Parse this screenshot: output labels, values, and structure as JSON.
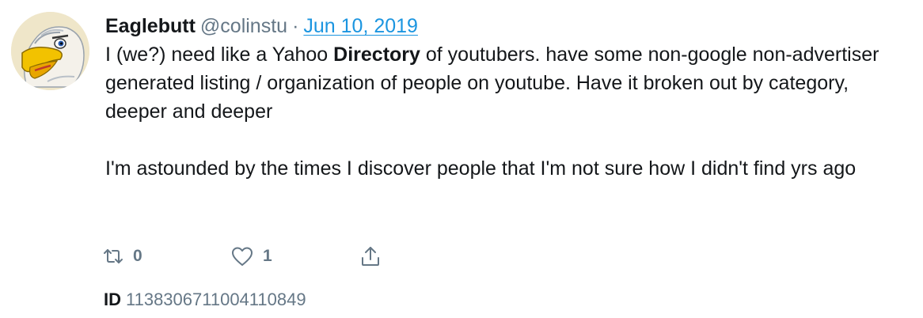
{
  "tweet": {
    "display_name": "Eaglebutt",
    "handle": "@colinstu",
    "separator": "·",
    "date": "Jun 10, 2019",
    "para1_a": "I (we?) need like a Yahoo ",
    "para1_bold": "Directory",
    "para1_b": " of youtubers. have some non-google non-advertiser generated listing / organization of people on youtube. Have it broken out by category, deeper and deeper",
    "para2": "I'm astounded by the times I discover people that I'm not sure how I didn't find yrs ago"
  },
  "actions": {
    "retweet_count": "0",
    "like_count": "1",
    "retweet_icon": "retweet-icon",
    "like_icon": "heart-icon",
    "share_icon": "share-icon"
  },
  "meta": {
    "id_label": "ID",
    "id_value": "1138306711004110849"
  },
  "colors": {
    "link": "#1b95e0",
    "secondary": "#657786",
    "text": "#14171a"
  }
}
